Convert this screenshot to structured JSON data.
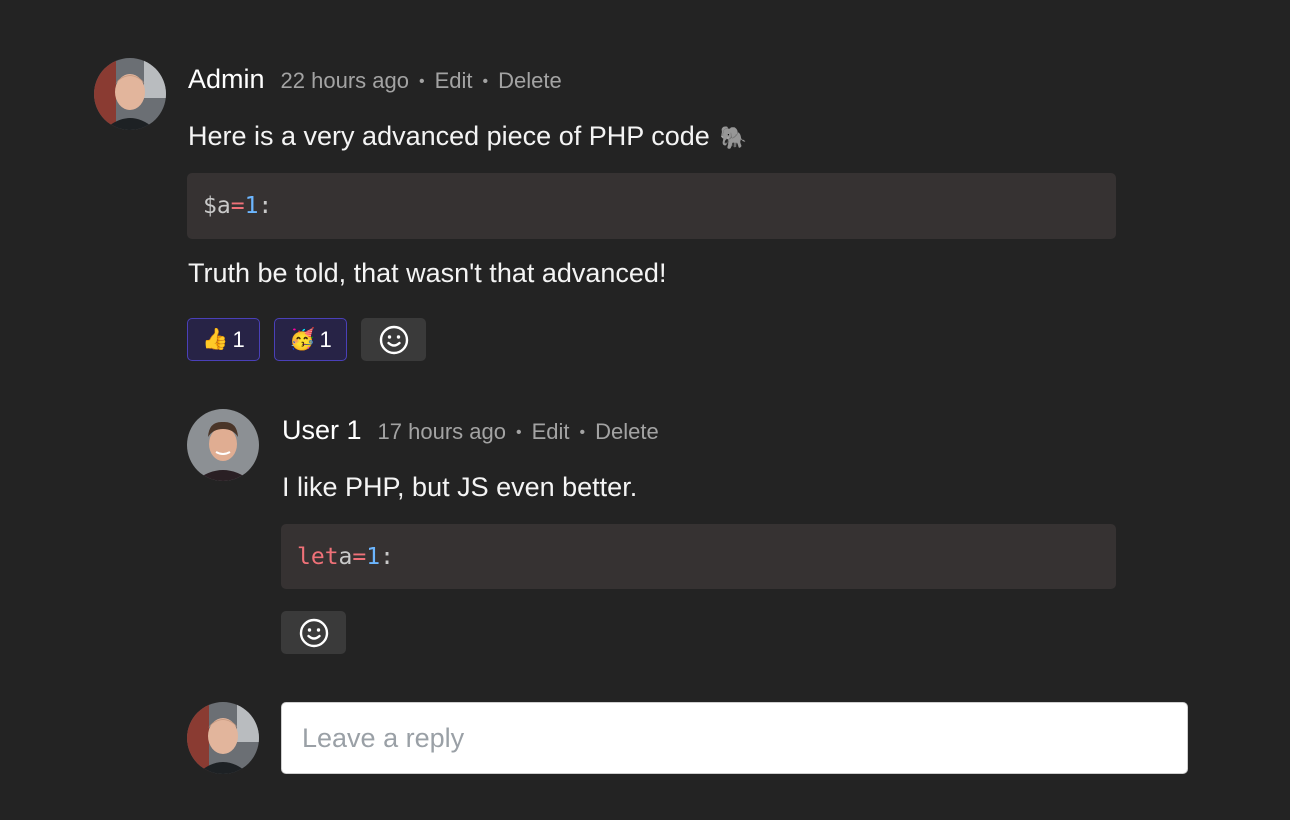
{
  "comments": [
    {
      "author": "Admin",
      "time": "22 hours ago",
      "edit_label": "Edit",
      "delete_label": "Delete",
      "text_before": "Here is a very advanced piece of PHP code",
      "text_after": "Truth be told, that wasn't that advanced!",
      "code_tokens": [
        "$a",
        "=",
        "1",
        ":"
      ],
      "reactions": [
        {
          "emoji": "👍",
          "count": "1"
        },
        {
          "emoji": "🥳",
          "count": "1"
        }
      ],
      "add_reaction_icon": "smiley-icon"
    },
    {
      "author": "User 1",
      "time": "17 hours ago",
      "edit_label": "Edit",
      "delete_label": "Delete",
      "text_before": "I like PHP, but JS even better.",
      "code_tokens": [
        "let",
        "a",
        "=",
        "1",
        ":"
      ],
      "add_reaction_icon": "smiley-icon"
    }
  ],
  "reply": {
    "placeholder": "Leave a reply"
  },
  "icons": {
    "elephant": "🐘",
    "separator": "•"
  },
  "colors": {
    "background": "#232323",
    "code_background": "#363232",
    "reaction_active_bg": "#272346",
    "reaction_active_border": "#4a40b8",
    "token_operator": "#f07178",
    "token_number": "#6cb6ff"
  }
}
